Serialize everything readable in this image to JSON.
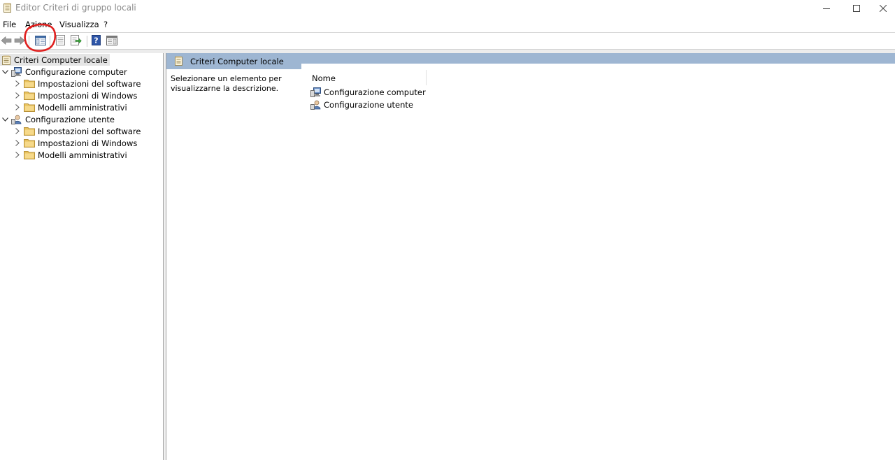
{
  "window": {
    "title": "Editor Criteri di gruppo locali",
    "controls": [
      "minimize",
      "maximize",
      "close"
    ]
  },
  "menu": {
    "items": [
      "File",
      "Azione",
      "Visualizza",
      "?"
    ]
  },
  "toolbar": {
    "buttons": [
      "back-icon",
      "forward-icon",
      "show-hide-console-tree-icon",
      "properties-icon",
      "export-list-icon",
      "help-icon",
      "show-hide-action-pane-icon"
    ],
    "highlighted": "show-hide-console-tree-icon",
    "annotation_color": "#e0201f"
  },
  "tree": {
    "root": "Criteri Computer locale",
    "sections": [
      {
        "label": "Configurazione computer",
        "children": [
          "Impostazioni del software",
          "Impostazioni di Windows",
          "Modelli amministrativi"
        ]
      },
      {
        "label": "Configurazione utente",
        "children": [
          "Impostazioni del software",
          "Impostazioni di Windows",
          "Modelli amministrativi"
        ]
      }
    ]
  },
  "content": {
    "header_title": "Criteri Computer locale",
    "description": "Selezionare un elemento per visualizzarne la descrizione.",
    "column_header": "Nome",
    "items": [
      "Configurazione computer",
      "Configurazione utente"
    ]
  },
  "colors": {
    "header_band": "#9eb6d2",
    "tree_selected": "#e5e5e5",
    "folder": "#e8c25d"
  }
}
